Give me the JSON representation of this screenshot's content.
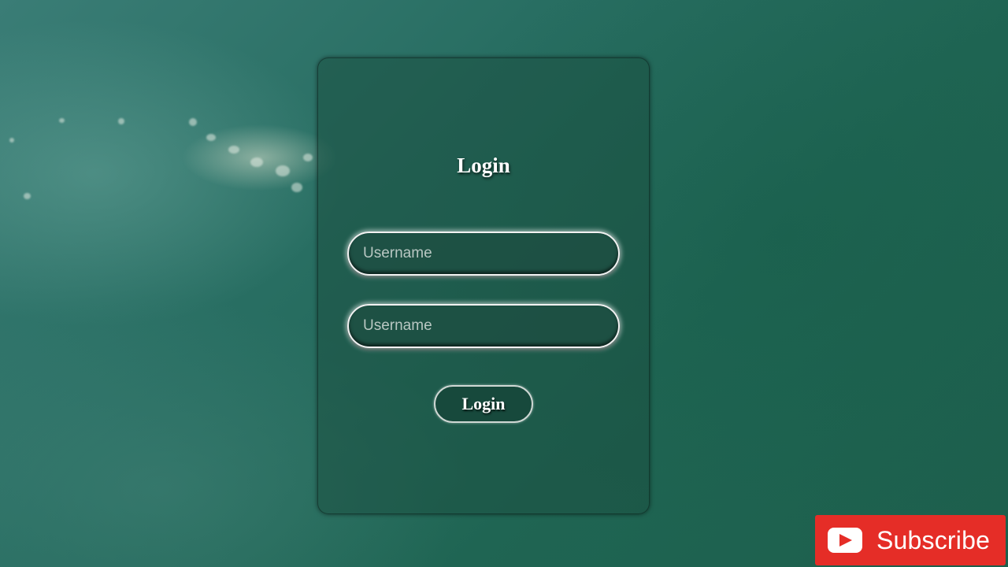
{
  "login_form": {
    "title": "Login",
    "username_placeholder": "Username",
    "password_placeholder": "Username",
    "submit_label": "Login"
  },
  "overlay": {
    "subscribe_label": "Subscribe",
    "icon": "youtube-play-icon"
  },
  "colors": {
    "subscribe_red": "#e52d27",
    "background_teal": "#286e62",
    "text_white": "#ffffff"
  }
}
